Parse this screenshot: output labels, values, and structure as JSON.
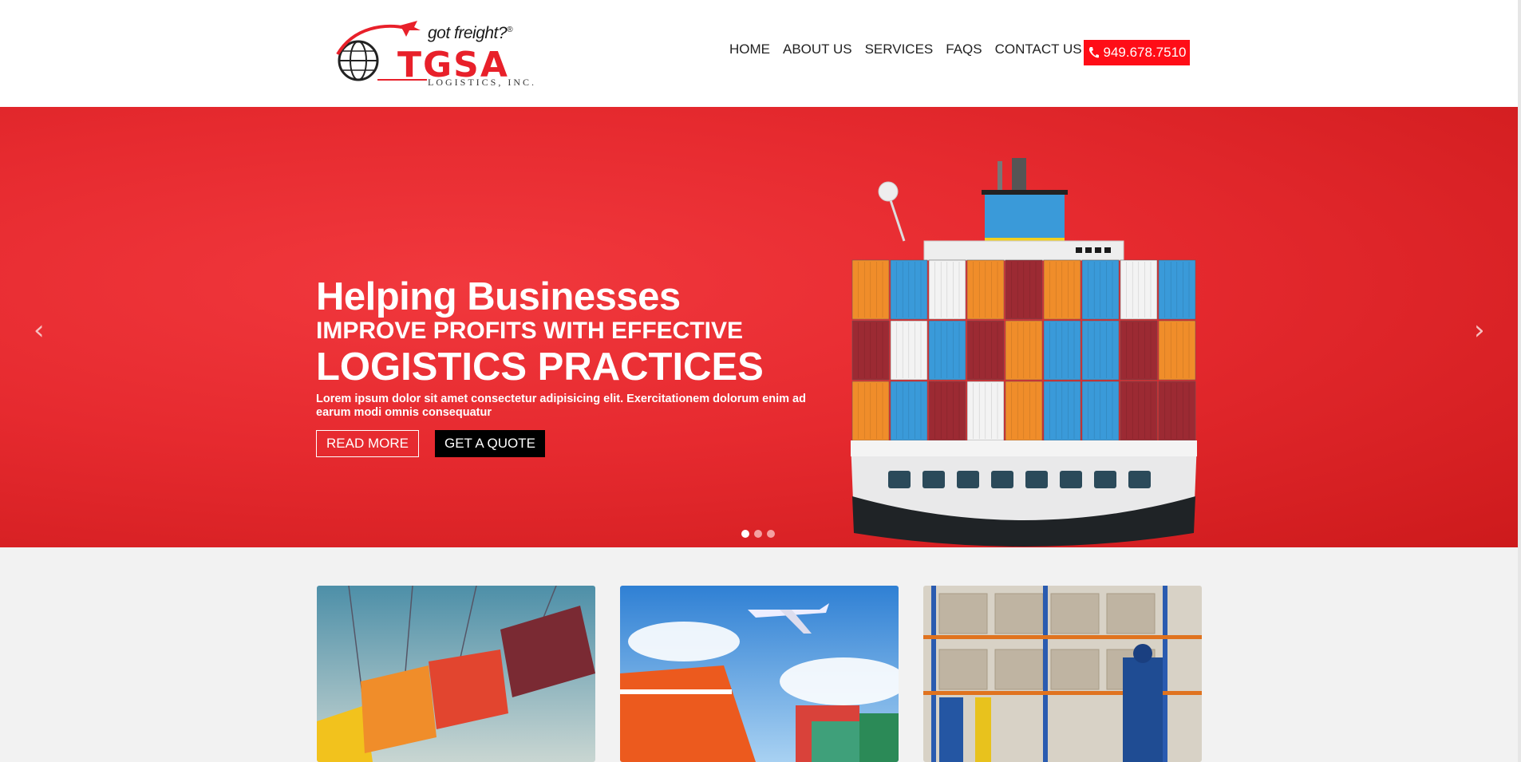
{
  "header": {
    "tagline": "got freight?",
    "tagline_mark": "®",
    "brand": "TGSA",
    "brand_sub": "LOGISTICS, INC.",
    "nav": [
      "HOME",
      "ABOUT US",
      "SERVICES",
      "FAQS",
      "CONTACT US"
    ],
    "phone": "949.678.7510"
  },
  "hero": {
    "heading_1": "Helping Businesses",
    "heading_2": "IMPROVE PROFITS WITH EFFECTIVE",
    "heading_3": "LOGISTICS PRACTICES",
    "body": "Lorem ipsum dolor sit amet consectetur adipisicing elit. Exercitationem dolorum enim ad earum modi omnis consequatur",
    "read_more": "READ MORE",
    "get_quote": "GET A QUOTE",
    "prev_arrow": "‹",
    "next_arrow": "›",
    "slides_total": 3,
    "slide_active": 1
  },
  "colors": {
    "accent": "#ff0d17",
    "hero_red": "#e62a2f"
  },
  "cards": [
    {
      "icon": "hanging-containers-image"
    },
    {
      "icon": "ship-and-plane-image"
    },
    {
      "icon": "warehouse-workers-image"
    }
  ]
}
